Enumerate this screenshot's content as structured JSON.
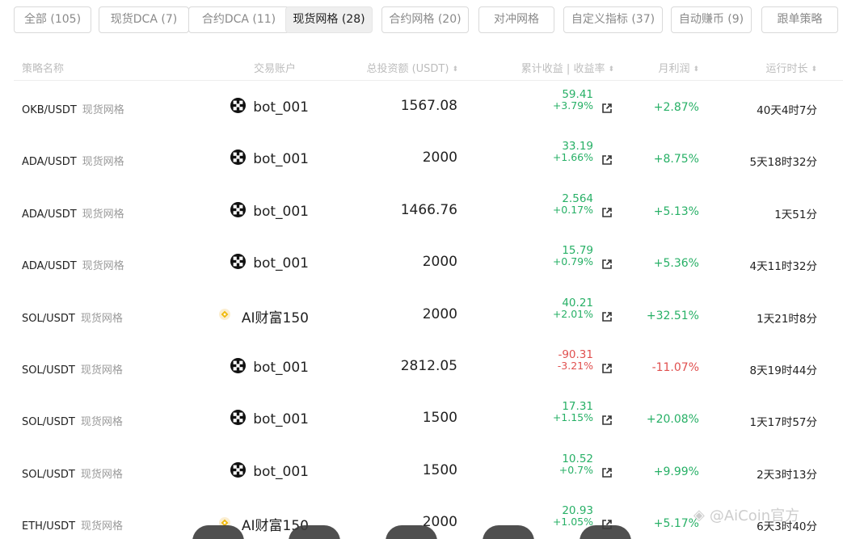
{
  "tabs": [
    {
      "label": "全部 (105)",
      "active": false
    },
    {
      "label": "现货DCA (7)",
      "active": false
    },
    {
      "label": "合约DCA (11)",
      "active": false
    },
    {
      "label": "现货网格 (28)",
      "active": true
    },
    {
      "label": "合约网格 (20)",
      "active": false
    },
    {
      "label": "对冲网格",
      "active": false
    },
    {
      "label": "自定义指标 (37)",
      "active": false
    },
    {
      "label": "自动赚币 (9)",
      "active": false
    },
    {
      "label": "跟单策略",
      "active": false
    }
  ],
  "columns": {
    "name": "策略名称",
    "account": "交易账户",
    "investment": "总投资额 (USDT)",
    "pnl": "累计收益 | 收益率",
    "monthly": "月利润",
    "duration": "运行时长"
  },
  "rows": [
    {
      "pair": "OKB/USDT",
      "type": "现货网格",
      "account": "bot_001",
      "account_icon": "okx-logo-icon",
      "investment": "1567.08",
      "pnl": "59.41",
      "rate": "+3.79%",
      "positive": true,
      "monthly": "+2.87%",
      "duration": "40天4时7分"
    },
    {
      "pair": "ADA/USDT",
      "type": "现货网格",
      "account": "bot_001",
      "account_icon": "okx-logo-icon",
      "investment": "2000",
      "pnl": "33.19",
      "rate": "+1.66%",
      "positive": true,
      "monthly": "+8.75%",
      "duration": "5天18时32分"
    },
    {
      "pair": "ADA/USDT",
      "type": "现货网格",
      "account": "bot_001",
      "account_icon": "okx-logo-icon",
      "investment": "1466.76",
      "pnl": "2.564",
      "rate": "+0.17%",
      "positive": true,
      "monthly": "+5.13%",
      "duration": "1天51分"
    },
    {
      "pair": "ADA/USDT",
      "type": "现货网格",
      "account": "bot_001",
      "account_icon": "okx-logo-icon",
      "investment": "2000",
      "pnl": "15.79",
      "rate": "+0.79%",
      "positive": true,
      "monthly": "+5.36%",
      "duration": "4天11时32分"
    },
    {
      "pair": "SOL/USDT",
      "type": "现货网格",
      "account": "AI财富150",
      "account_icon": "binance-logo-icon",
      "investment": "2000",
      "pnl": "40.21",
      "rate": "+2.01%",
      "positive": true,
      "monthly": "+32.51%",
      "duration": "1天21时8分"
    },
    {
      "pair": "SOL/USDT",
      "type": "现货网格",
      "account": "bot_001",
      "account_icon": "okx-logo-icon",
      "investment": "2812.05",
      "pnl": "-90.31",
      "rate": "-3.21%",
      "positive": false,
      "monthly": "-11.07%",
      "duration": "8天19时44分"
    },
    {
      "pair": "SOL/USDT",
      "type": "现货网格",
      "account": "bot_001",
      "account_icon": "okx-logo-icon",
      "investment": "1500",
      "pnl": "17.31",
      "rate": "+1.15%",
      "positive": true,
      "monthly": "+20.08%",
      "duration": "1天17时57分"
    },
    {
      "pair": "SOL/USDT",
      "type": "现货网格",
      "account": "bot_001",
      "account_icon": "okx-logo-icon",
      "investment": "1500",
      "pnl": "10.52",
      "rate": "+0.7%",
      "positive": true,
      "monthly": "+9.99%",
      "duration": "2天3时13分"
    },
    {
      "pair": "ETH/USDT",
      "type": "现货网格",
      "account": "AI财富150",
      "account_icon": "binance-logo-icon",
      "investment": "2000",
      "pnl": "20.93",
      "rate": "+1.05%",
      "positive": true,
      "monthly": "+5.17%",
      "duration": "6天3时40分"
    }
  ],
  "watermark": "@AiCoin官方",
  "colors": {
    "positive": "#27b066",
    "negative": "#e0504f"
  }
}
